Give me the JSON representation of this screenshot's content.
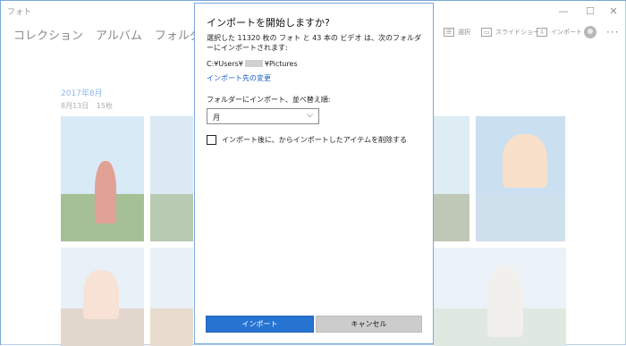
{
  "window": {
    "title": "フォト",
    "minimize_glyph": "—",
    "maximize_glyph": "☐",
    "close_glyph": "✕"
  },
  "nav": {
    "tabs": [
      "コレクション",
      "アルバム",
      "フォルダー"
    ]
  },
  "toolbar": {
    "select_icon": "select-list-icon",
    "select_label": "選択",
    "slideshow_icon": "slideshow-icon",
    "slideshow_label": "スライドショー",
    "import_icon": "import-icon",
    "import_label": "インポート",
    "avatar_icon": "user-avatar-icon",
    "more_glyph": "···"
  },
  "timeline": {
    "month": "2017年8月",
    "day": "8月13日",
    "count": "15枚"
  },
  "dialog": {
    "title": "インポートを開始しますか?",
    "message": "選択した 11320 枚の フォト と 43 本の ビデオ は、次のフォルダーにインポートされます:",
    "path_prefix": "C:¥Users¥",
    "path_suffix": "¥Pictures",
    "change_destination": "インポート先の変更",
    "organize_label": "フォルダーにインポート、並べ替え順:",
    "organize_value": "月",
    "delete_after_import_label": "インポート後に、からインポートしたアイテムを削除する",
    "delete_after_import_checked": false,
    "import_button": "インポート",
    "cancel_button": "キャンセル"
  },
  "colors": {
    "accent": "#2673d1",
    "link": "#1a5fc4",
    "date_header": "#2f7bd4"
  }
}
